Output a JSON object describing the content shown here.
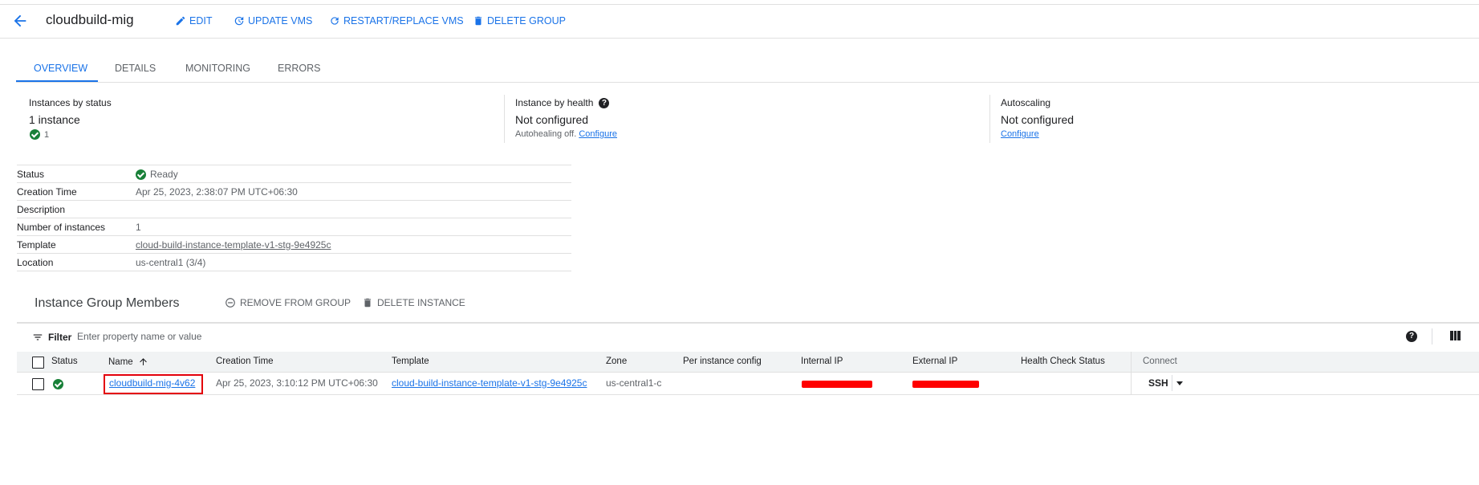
{
  "header": {
    "title": "cloudbuild-mig",
    "edit_label": "EDIT",
    "update_label": "UPDATE VMS",
    "restart_label": "RESTART/REPLACE VMS",
    "delete_label": "DELETE GROUP"
  },
  "tabs": [
    {
      "label": "OVERVIEW",
      "active": true
    },
    {
      "label": "DETAILS"
    },
    {
      "label": "MONITORING"
    },
    {
      "label": "ERRORS"
    }
  ],
  "cards": {
    "status": {
      "heading": "Instances by status",
      "value": "1 instance",
      "count": "1"
    },
    "health": {
      "heading": "Instance by health",
      "value": "Not configured",
      "note": "Autohealing off.",
      "link": "Configure"
    },
    "autoscaling": {
      "heading": "Autoscaling",
      "value": "Not configured",
      "link": "Configure"
    }
  },
  "details": [
    {
      "key": "Status",
      "value": "Ready"
    },
    {
      "key": "Creation Time",
      "value": "Apr 25, 2023, 2:38:07 PM UTC+06:30"
    },
    {
      "key": "Description",
      "value": ""
    },
    {
      "key": "Number of instances",
      "value": "1"
    },
    {
      "key": "Template",
      "value": "cloud-build-instance-template-v1-stg-9e4925c"
    },
    {
      "key": "Location",
      "value": "us-central1 (3/4)"
    }
  ],
  "members": {
    "title": "Instance Group Members",
    "remove_label": "REMOVE FROM GROUP",
    "delete_label": "DELETE INSTANCE",
    "filter_label": "Filter",
    "filter_placeholder": "Enter property name or value",
    "columns": [
      "Status",
      "Name",
      "Creation Time",
      "Template",
      "Zone",
      "Per instance config",
      "Internal IP",
      "External IP",
      "Health Check Status",
      "Connect"
    ],
    "rows": [
      {
        "name": "cloudbuild-mig-4v62",
        "creation_time": "Apr 25, 2023, 3:10:12 PM UTC+06:30",
        "template": "cloud-build-instance-template-v1-stg-9e4925c",
        "zone": "us-central1-c",
        "connect": "SSH"
      }
    ]
  },
  "colors": {
    "accent": "#1a73e8",
    "success": "#188038",
    "highlight": "#e3000b"
  }
}
